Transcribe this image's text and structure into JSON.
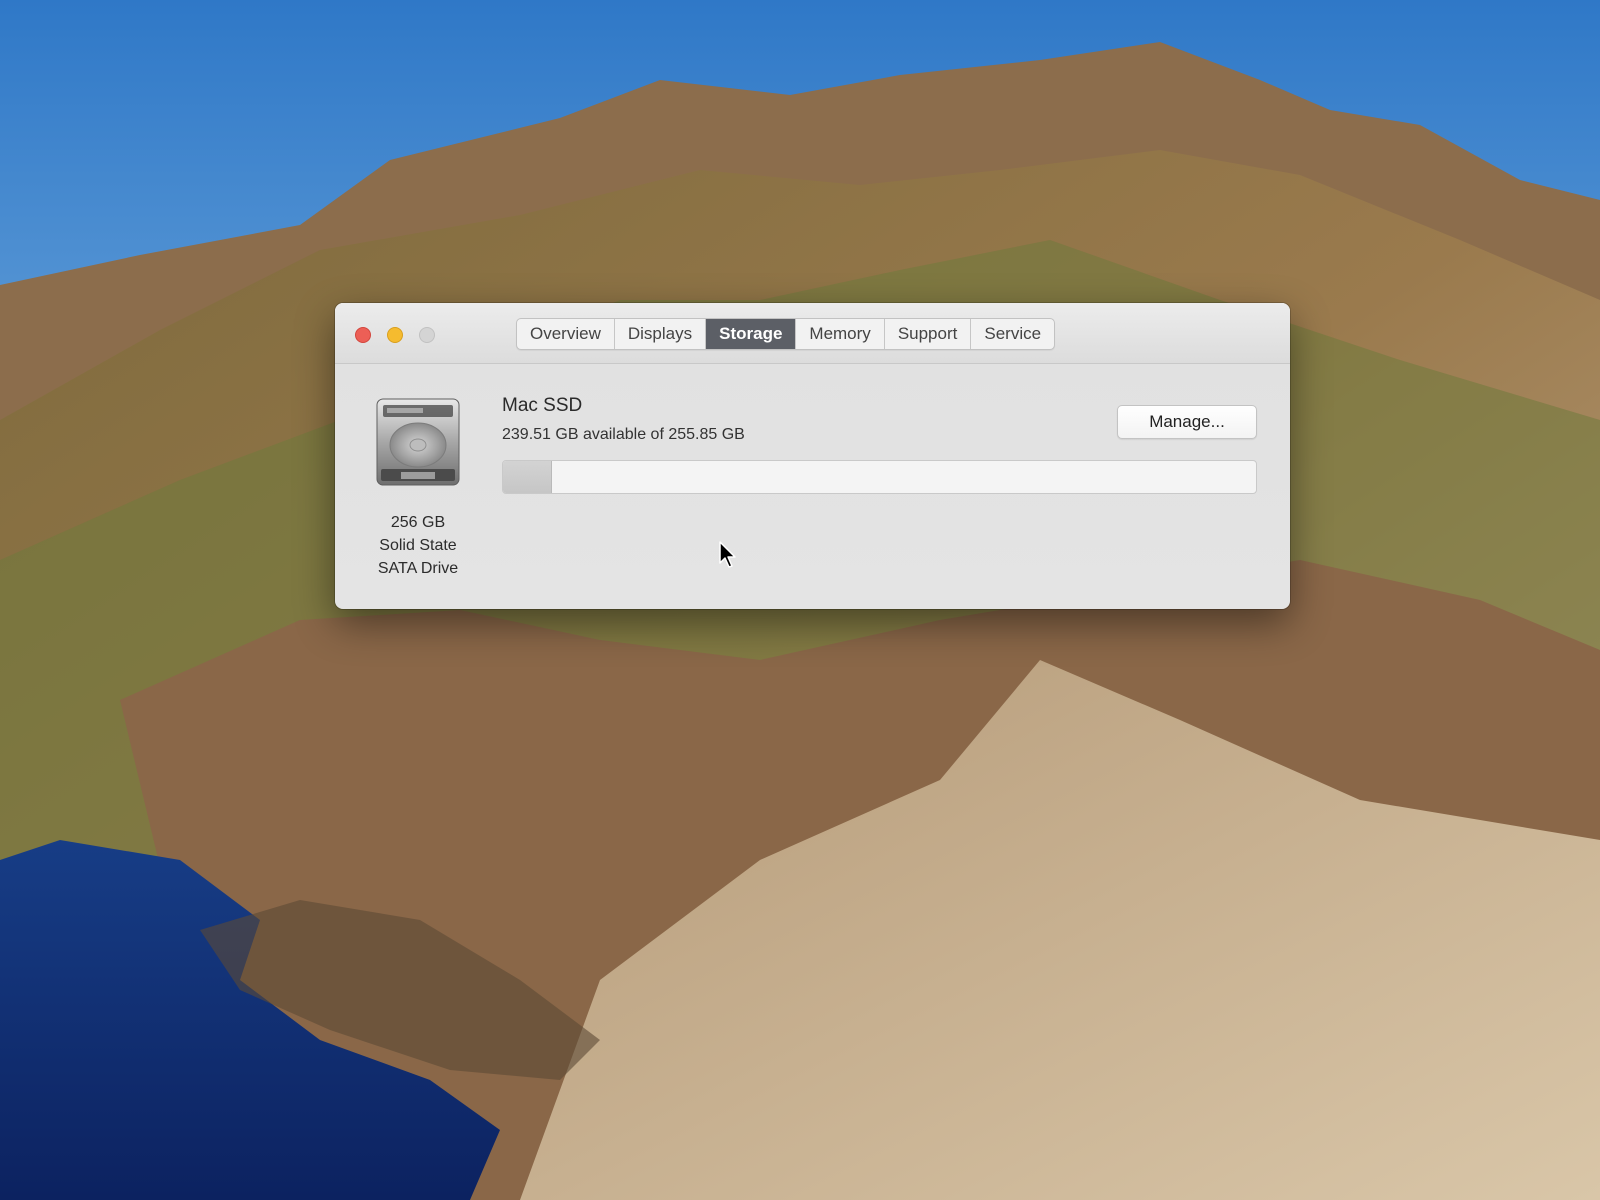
{
  "window": {
    "title_tabs": [
      {
        "label": "Overview",
        "active": false
      },
      {
        "label": "Displays",
        "active": false
      },
      {
        "label": "Storage",
        "active": true
      },
      {
        "label": "Memory",
        "active": false
      },
      {
        "label": "Support",
        "active": false
      },
      {
        "label": "Service",
        "active": false
      }
    ],
    "traffic_lights": {
      "close": "#ec5f56",
      "minimize": "#f5bb2f",
      "zoom": "#d4d4d4"
    }
  },
  "drive": {
    "icon": "hard-drive-icon",
    "capacity": "256 GB",
    "type": "Solid State",
    "interface": "SATA Drive"
  },
  "volume": {
    "name": "Mac SSD",
    "availability": "239.51 GB available of 255.85 GB",
    "used_fraction": 0.064
  },
  "actions": {
    "manage_label": "Manage..."
  },
  "colors": {
    "active_tab": "#5c5f66",
    "window_bg": "#e4e4e4"
  }
}
